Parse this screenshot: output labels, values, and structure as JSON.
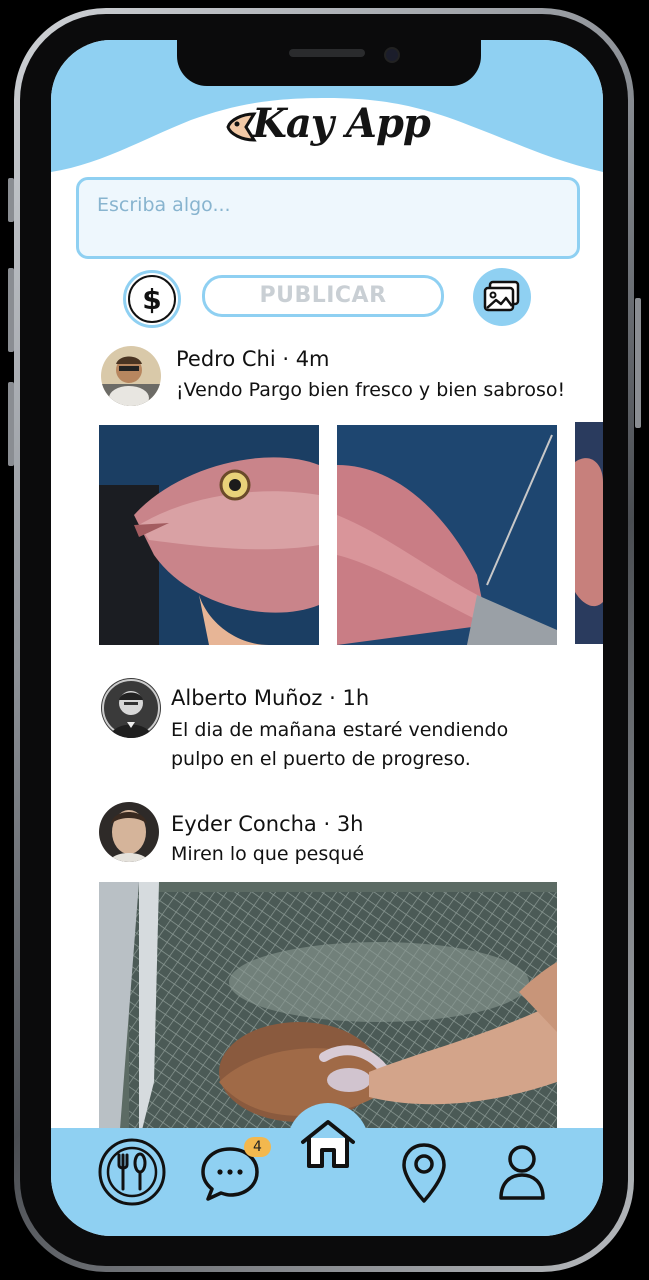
{
  "app": {
    "title": "Kay App"
  },
  "composer": {
    "placeholder": "Escriba algo...",
    "publish_label": "PUBLICAR",
    "price_icon": "dollar-icon",
    "photo_icon": "image-icon"
  },
  "posts": [
    {
      "author": "Pedro Chi · 4m",
      "text": "¡Vendo Pargo bien fresco y bien sabroso!"
    },
    {
      "author": "Alberto Muñoz · 1h",
      "text_line1": "El dia de mañana estaré vendiendo",
      "text_line2": "pulpo en el puerto de progreso."
    },
    {
      "author": "Eyder Concha · 3h",
      "text": "Miren lo que pesqué"
    }
  ],
  "nav": {
    "messages_badge": "4",
    "items": [
      "restaurant-icon",
      "chat-icon",
      "home-icon",
      "location-icon",
      "profile-icon"
    ]
  },
  "colors": {
    "accent": "#8fd0f2",
    "badge": "#f3b84e"
  }
}
